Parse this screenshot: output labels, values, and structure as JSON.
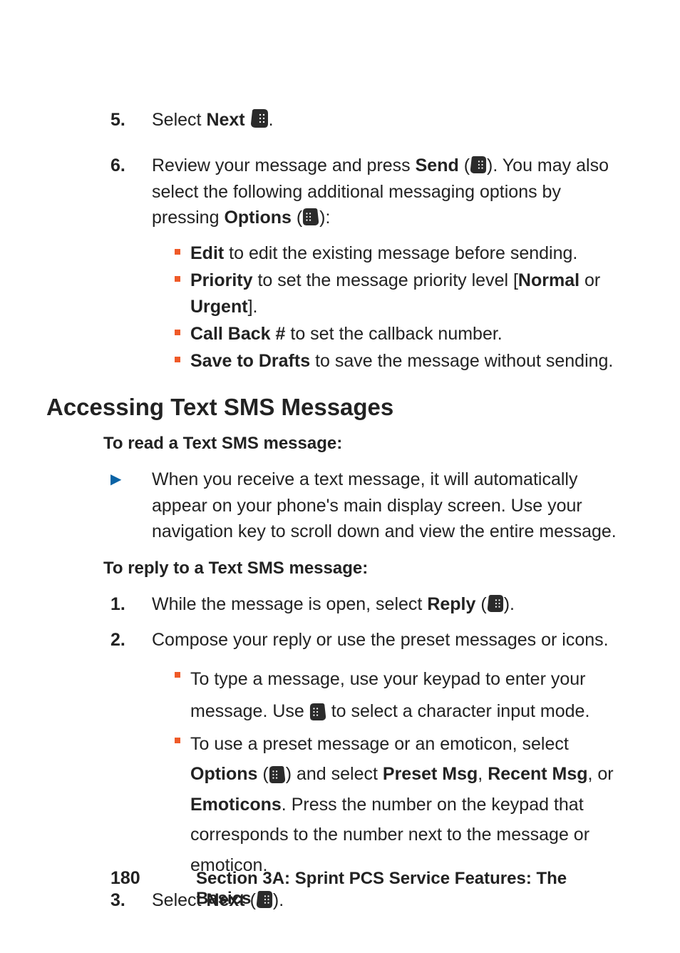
{
  "steps_a": {
    "n5": "5.",
    "n6": "6.",
    "s5_pre": "Select ",
    "s5_next": "Next",
    "s5_post": ".",
    "s6_l1_a": "Review your message and press ",
    "s6_send": "Send",
    "s6_l1_b": " (",
    "s6_l1_c": "). You may also select the following additional messaging options by ",
    "s6_l2_a": "pressing ",
    "s6_options": "Options",
    "s6_l2_b": " (",
    "s6_l2_c": "):"
  },
  "sub_a": {
    "edit_b": "Edit",
    "edit_t": " to edit the existing message before sending.",
    "pri_b": "Priority",
    "pri_t_a": " to set the message priority level [",
    "pri_normal": "Normal",
    "pri_or": " or ",
    "pri_urgent": "Urgent",
    "pri_t_b": "].",
    "cb_b": "Call Back #",
    "cb_t": " to set the callback number.",
    "sd_b": "Save to Drafts",
    "sd_t": " to save the message without sending."
  },
  "heading": "Accessing Text SMS Messages",
  "read_h": "To read a Text SMS message:",
  "read_body": "When you receive a text message, it will automatically appear on your phone's main display screen. Use your navigation key to scroll down and view the entire message.",
  "reply_h": "To reply to a Text SMS message:",
  "steps_b": {
    "n1": "1.",
    "n2": "2.",
    "n3": "3.",
    "s1_a": "While the message is open, select ",
    "s1_reply": "Reply",
    "s1_b": " (",
    "s1_c": ").",
    "s2": "Compose your reply or use the preset messages or icons.",
    "s3_a": "Select ",
    "s3_next": "Next",
    "s3_b": " (",
    "s3_c": ")."
  },
  "sub_b": {
    "type_a": "To type a message, use your keypad to enter your message. Use ",
    "type_b": " to select a character input mode.",
    "preset_a": "To use a preset message or an emoticon, select ",
    "preset_options": "Options",
    "preset_b": " (",
    "preset_c": ") and select ",
    "preset_msg": "Preset Msg",
    "comma1": ", ",
    "recent_msg": "Recent Msg",
    "or": ", or ",
    "emoticons": "Emoticons",
    "preset_d": ". Press the number on the keypad that corresponds to the number next to the message or emoticon."
  },
  "footer": {
    "page": "180",
    "section": "Section 3A: Sprint PCS Service Features: The Basics"
  }
}
